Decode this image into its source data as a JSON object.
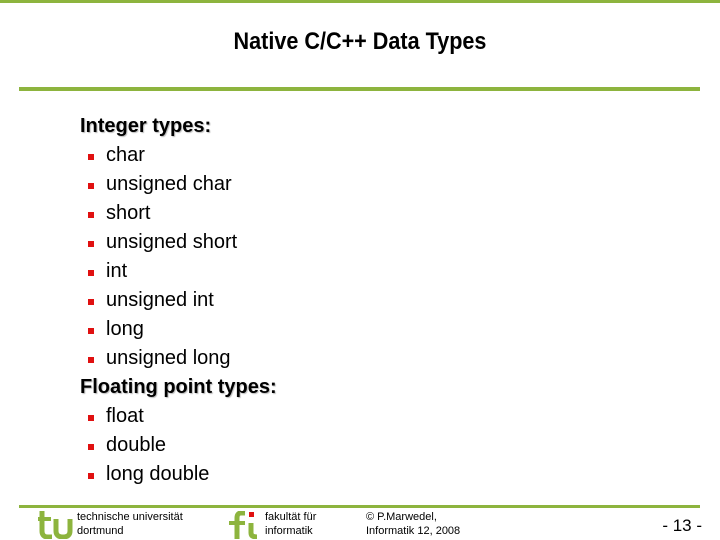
{
  "slide": {
    "title": "Native C/C++ Data Types",
    "sections": [
      {
        "heading": "Integer types:",
        "items": [
          "char",
          "unsigned char",
          "short",
          "unsigned short",
          "int",
          "unsigned int",
          "long",
          "unsigned long"
        ]
      },
      {
        "heading": "Floating point types:",
        "items": [
          "float",
          "double",
          "long double"
        ]
      }
    ]
  },
  "footer": {
    "tu_line1": "technische universität",
    "tu_line2": "dortmund",
    "fi_line1": "fakultät für",
    "fi_line2": "informatik",
    "copyright_line1": "© P.Marwedel,",
    "copyright_line2": "Informatik 12,   2008",
    "page_number": "-  13 -"
  },
  "colors": {
    "accent": "#8db43e",
    "bullet": "#e01010"
  }
}
